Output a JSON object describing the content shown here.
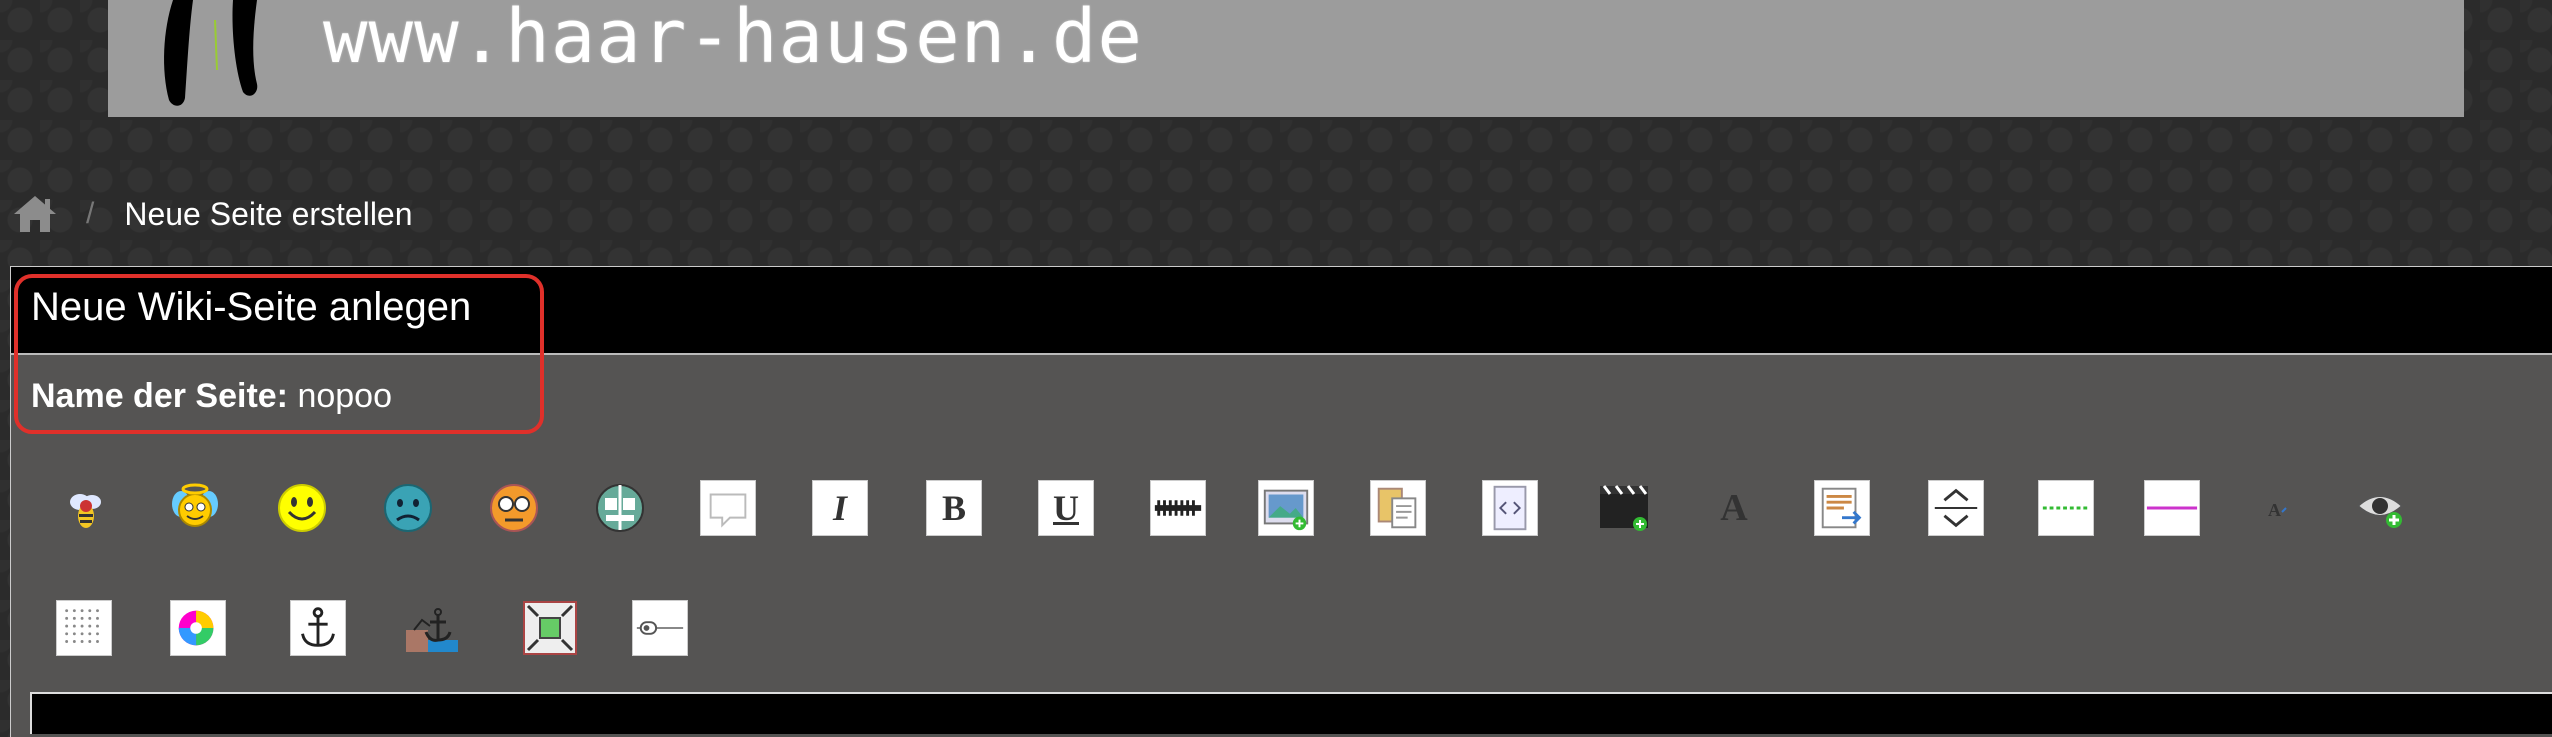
{
  "banner": {
    "site_url": "www.haar-hausen.de"
  },
  "breadcrumb": {
    "separator": "/",
    "current": "Neue Seite erstellen"
  },
  "panel": {
    "title": "Neue Wiki-Seite anlegen",
    "page_name_label": "Name der Seite:",
    "page_name_value": "nopoo"
  },
  "toolbar": {
    "row1": [
      "bee-smiley-icon",
      "angel-smiley-icon",
      "happy-smiley-icon",
      "sad-smiley-icon",
      "cool-smiley-icon",
      "crazy-smiley-icon",
      "speech-bubble-icon",
      "italic-icon",
      "bold-icon",
      "underline-icon",
      "strikethrough-icon",
      "insert-image-icon",
      "paste-icon",
      "code-icon",
      "video-icon",
      "font-size-icon",
      "text-format-icon",
      "collapse-icon",
      "dotted-line-icon",
      "horizontal-rule-icon",
      "small-font-icon",
      "preview-eye-icon"
    ],
    "row2": [
      "table-grid-icon",
      "color-picker-icon",
      "anchor-icon",
      "link-anchor-icon",
      "fullscreen-icon",
      "slider-icon"
    ],
    "italic_glyph": "I",
    "bold_glyph": "B",
    "underline_glyph": "U",
    "font_glyph": "A"
  },
  "colors": {
    "highlight": "#e0302a",
    "panel_bg": "#555453",
    "header_bg": "#000000"
  }
}
